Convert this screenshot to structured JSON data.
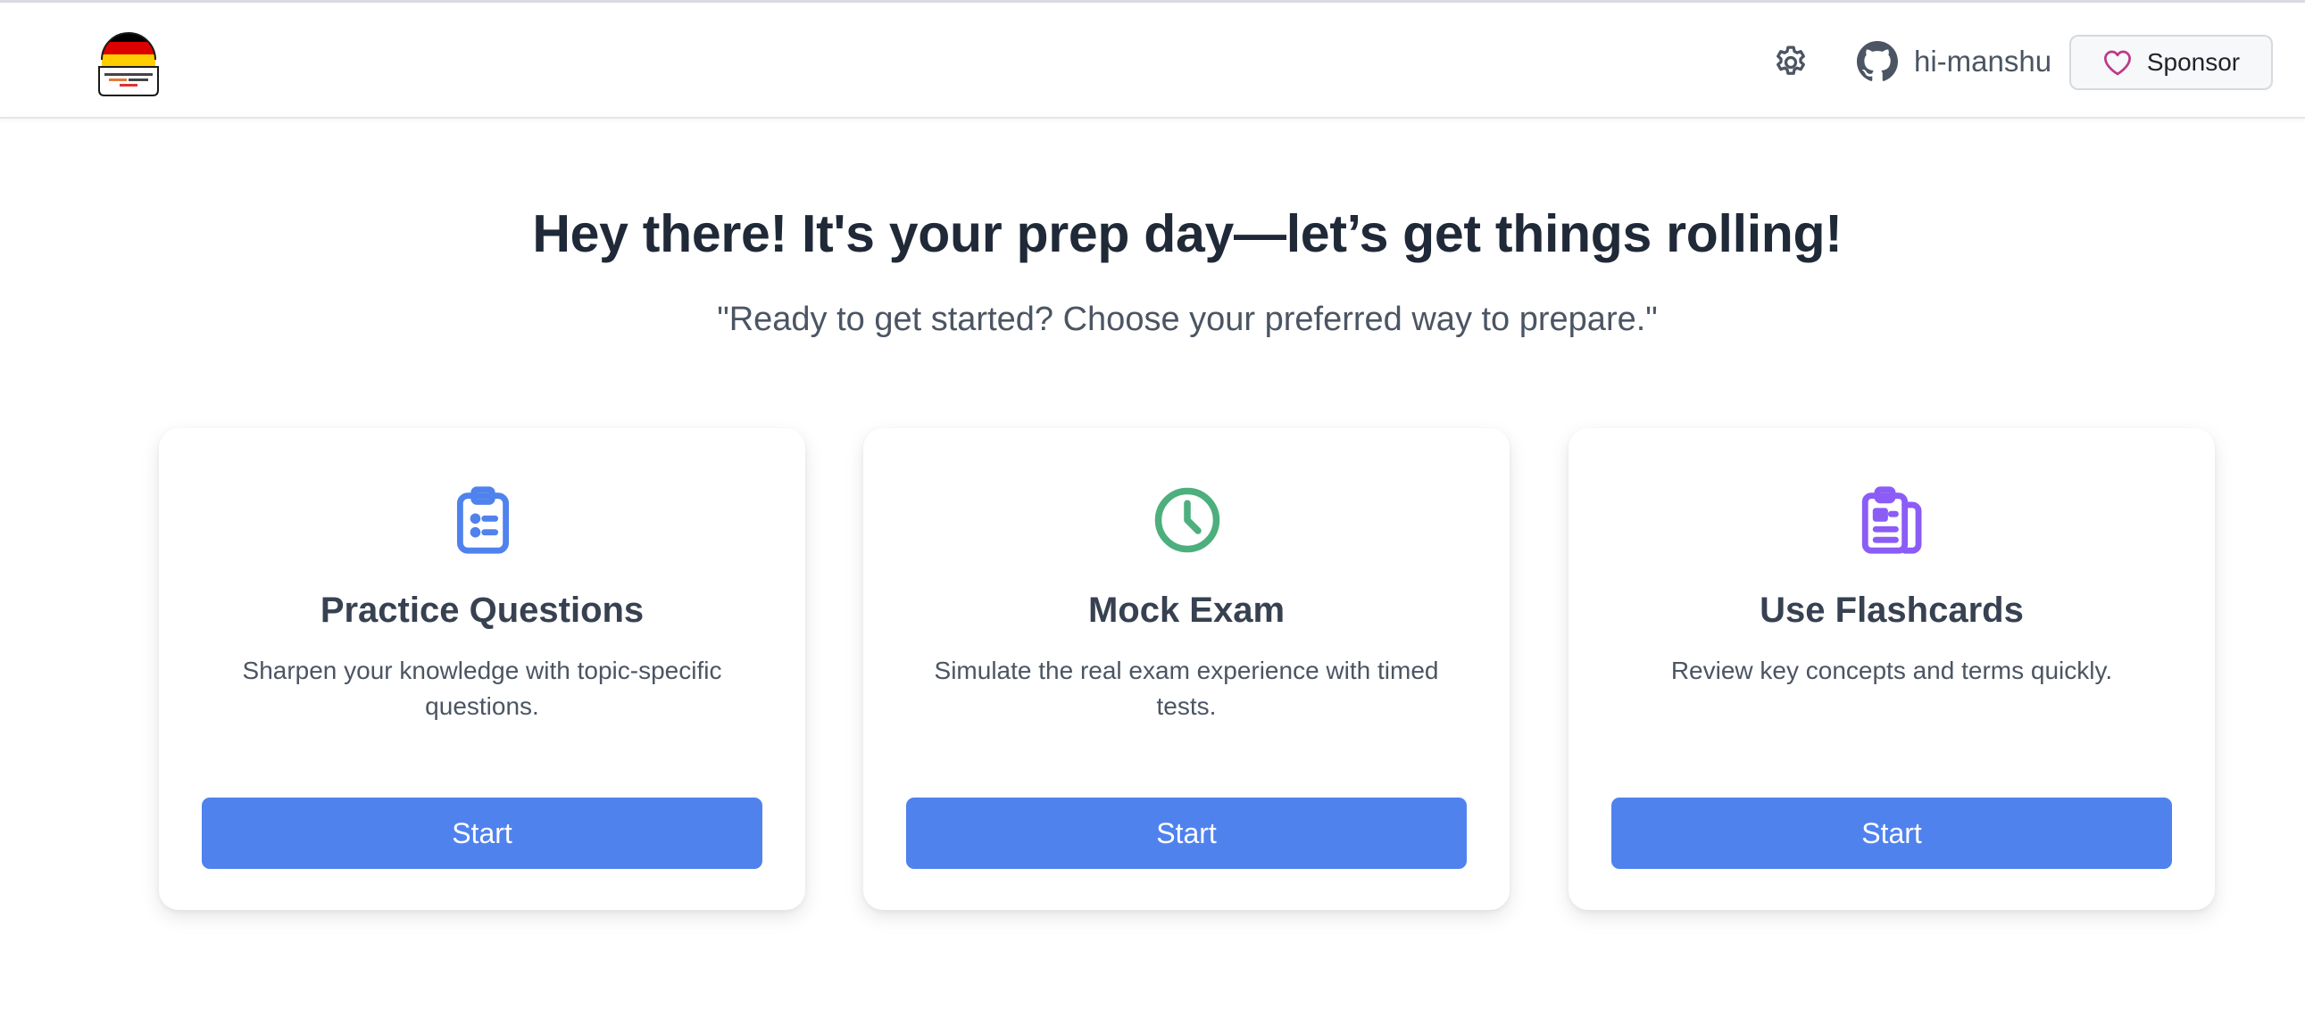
{
  "header": {
    "logo_icon": "germany-flag-bell-logo",
    "settings_icon": "gear-icon",
    "github_icon": "github-icon",
    "github_user": "hi-manshu",
    "sponsor_icon": "heart-icon",
    "sponsor_label": "Sponsor"
  },
  "hero": {
    "title": "Hey there! It's your prep day—let’s get things rolling!",
    "subtitle": "\"Ready to get started? Choose your preferred way to prepare.\""
  },
  "cards": [
    {
      "icon": "clipboard-list-icon",
      "icon_color": "#4f82ed",
      "title": "Practice Questions",
      "description": "Sharpen your knowledge with topic-specific questions.",
      "button": "Start"
    },
    {
      "icon": "clock-icon",
      "icon_color": "#4caf7d",
      "title": "Mock Exam",
      "description": "Simulate the real exam experience with timed tests.",
      "button": "Start"
    },
    {
      "icon": "flashcards-icon",
      "icon_color": "#8b5cf6",
      "title": "Use Flashcards",
      "description": "Review key concepts and terms quickly.",
      "button": "Start"
    }
  ],
  "colors": {
    "primary": "#4f82ed",
    "heading": "#1f2937",
    "muted": "#4b5563",
    "sponsor_heart": "#bf3989"
  }
}
